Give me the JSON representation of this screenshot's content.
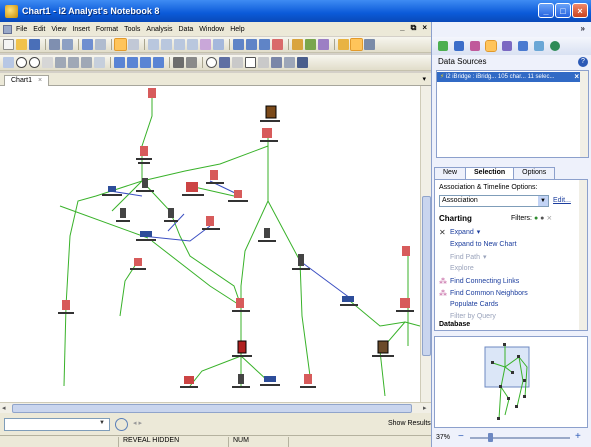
{
  "window": {
    "title": "Chart1 - i2 Analyst's Notebook 8",
    "controls": [
      "_",
      "□",
      "×"
    ]
  },
  "menubar": {
    "items": [
      "File",
      "Edit",
      "View",
      "Insert",
      "Format",
      "Tools",
      "Analysis",
      "Data",
      "Window",
      "Help"
    ],
    "mdi_controls": [
      "_",
      "⧉",
      "×"
    ]
  },
  "document_tab": {
    "label": "Chart1",
    "close": "×",
    "dropdown": "▾"
  },
  "search": {
    "placeholder": "",
    "results_label": "Show Results",
    "nav_prev": "◂",
    "nav_next": "▸"
  },
  "statusbar": {
    "reveal_hidden": "REVEAL HIDDEN",
    "num": "NUM"
  },
  "right_pane": {
    "expand_chevron": "»",
    "data_sources": {
      "title": "Data Sources",
      "help": "?",
      "items": [
        {
          "label": "i2 iBridge : iBridg...   105 char...   11 selec...",
          "close": "×"
        }
      ]
    },
    "tabs": [
      "New",
      "Selection",
      "Options"
    ],
    "selected_tab": "Selection",
    "options": {
      "label": "Association & Timeline Options:",
      "select_value": "Association",
      "edit_link": "Edit..."
    },
    "charting": {
      "title": "Charting",
      "filters_label": "Filters:",
      "commands": [
        {
          "label": "Expand",
          "enabled": true,
          "icon": "expand-icon"
        },
        {
          "label": "Expand to New Chart",
          "enabled": true,
          "icon": "none"
        },
        {
          "label": "Find Path",
          "enabled": false,
          "icon": "none"
        },
        {
          "label": "Explore",
          "enabled": false,
          "icon": "none"
        },
        {
          "label": "Find Connecting Links",
          "enabled": true,
          "icon": "connecting-links-icon"
        },
        {
          "label": "Find Common Neighbors",
          "enabled": true,
          "icon": "common-neighbors-icon"
        },
        {
          "label": "Populate Cards",
          "enabled": true,
          "icon": "none"
        },
        {
          "label": "Filter by Query",
          "enabled": false,
          "icon": "none"
        }
      ],
      "database_label": "Database"
    },
    "zoom": {
      "percent": "37%",
      "minus": "−",
      "plus": "+"
    }
  },
  "colors": {
    "title_bar": "#0b5ad9",
    "link_line": "#39b22a",
    "link_blue": "#3b4fc2",
    "selection": "#316ac5",
    "command_link": "#1c3e9e"
  }
}
